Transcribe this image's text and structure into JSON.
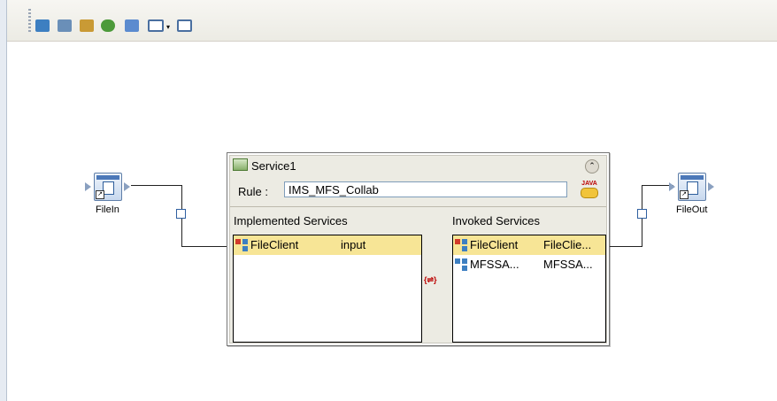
{
  "toolbar": {
    "buttons": [
      {
        "name": "add-service-icon",
        "color": "#3d7fc1"
      },
      {
        "name": "add-connector-icon",
        "color": "#6a8fb8"
      },
      {
        "name": "add-table-icon",
        "color": "#c99a35"
      },
      {
        "name": "add-entity-icon",
        "color": "#4c9a3a"
      },
      {
        "name": "add-image-icon",
        "color": "#5b8bcf"
      },
      {
        "name": "add-window-dropdown-icon",
        "color": "#4a6fa0"
      },
      {
        "name": "add-window-icon",
        "color": "#4a6fa0"
      }
    ]
  },
  "canvas": {
    "file_in": {
      "label": "FileIn"
    },
    "file_out": {
      "label": "FileOut"
    },
    "service": {
      "title": "Service1",
      "rule_label": "Rule :",
      "rule_value": "IMS_MFS_Collab",
      "java_badge": "JAVA",
      "implemented_header": "Implemented Services",
      "invoked_header": "Invoked Services",
      "implemented_rows": [
        {
          "name": "FileClient",
          "operation": "input",
          "selected": true
        }
      ],
      "invoked_rows": [
        {
          "name": "FileClient",
          "operation": "FileClie...",
          "selected": true
        },
        {
          "name": "MFSSA...",
          "operation": "MFSSA...",
          "selected": false
        }
      ]
    }
  },
  "colors": {
    "selection": "#f7e596",
    "wire": "#222222",
    "port": "#2f5fa0"
  }
}
